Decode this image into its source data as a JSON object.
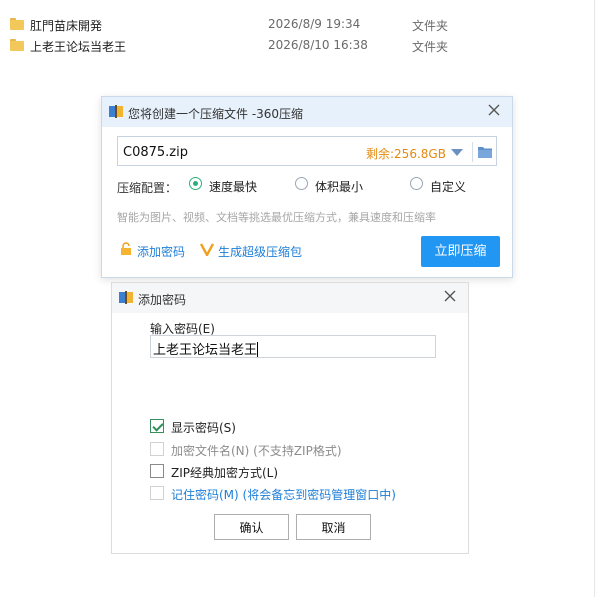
{
  "files": [
    {
      "name": "肛門苗床開発",
      "date": "2026/8/9 19:34",
      "type": "文件夹"
    },
    {
      "name": "上老王论坛当老王",
      "date": "2026/8/10 16:38",
      "type": "文件夹"
    }
  ],
  "compress_dialog": {
    "title": "您将创建一个压缩文件 -360压缩",
    "filename": "C0875.zip",
    "remaining": "剩余:256.8GB",
    "config_label": "压缩配置：",
    "options": [
      "速度最快",
      "体积最小",
      "自定义"
    ],
    "selected_option": "速度最快",
    "hint": "智能为图片、视频、文档等挑选最优压缩方式，兼具速度和压缩率",
    "add_password": "添加密码",
    "super_pack": "生成超级压缩包",
    "compress_now": "立即压缩"
  },
  "password_dialog": {
    "title": "添加密码",
    "input_label": "输入密码(E)",
    "password_value": "上老王论坛当老王",
    "checkboxes": [
      {
        "label": "显示密码(S)",
        "checked": true,
        "disabled": false
      },
      {
        "label": "加密文件名(N) (不支持ZIP格式)",
        "checked": false,
        "disabled": true
      },
      {
        "label": "ZIP经典加密方式(L)",
        "checked": false,
        "disabled": false
      },
      {
        "label": "记住密码(M) (将会备忘到密码管理窗口中)",
        "checked": false,
        "disabled": false
      }
    ],
    "ok": "确认",
    "cancel": "取消"
  },
  "colors": {
    "accent": "#2196f3",
    "warning": "#e48a10",
    "radio_on": "#2bb07a",
    "link": "#1e7fd8"
  }
}
